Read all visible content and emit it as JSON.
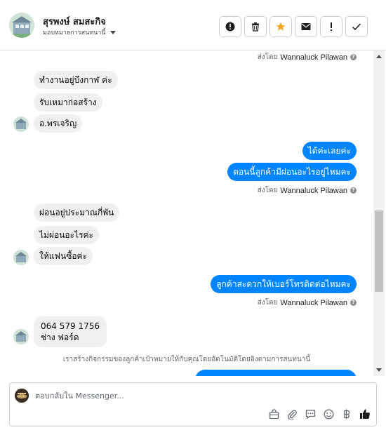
{
  "header": {
    "contact_name": "สุรพงษ์ สมสะกิจ",
    "assign_label": "มอบหมายการสนทนานี้",
    "actions": [
      {
        "icon": "alert-circle-icon"
      },
      {
        "icon": "trash-icon"
      },
      {
        "icon": "star-icon"
      },
      {
        "icon": "envelope-icon"
      },
      {
        "icon": "exclamation-icon"
      },
      {
        "icon": "check-icon"
      }
    ]
  },
  "conversation": {
    "sent_by_prefix": "ส่งโดย",
    "sent_by_name": "Wannaluck Pilawan",
    "incoming_group_1": [
      "ทำงานอยู่บึงกาฬ ค่ะ",
      "รับเหมาก่อสร้าง",
      "อ.พรเจริญ"
    ],
    "outgoing_group_1": [
      "ได้ค่ะเลยค่ะ",
      "ตอนนี้ลูกค้ามีผ่อนอะไรอยู่ไหมคะ"
    ],
    "incoming_group_2": [
      "ผ่อนอยู่ประมาณกี่พัน",
      "ไม่ผ่อนอะไรค่ะ",
      "ให้แฟนซื้อค่ะ"
    ],
    "outgoing_group_2": [
      "ลูกค้าสะดวกให้เบอร์โทรติดต่อไหมคะ"
    ],
    "incoming_group_3": [
      "064 579 1756",
      "ช่าง ฟอร์ด"
    ],
    "system_note": "เราสร้างกิจกรรมของลูกค้าเป้าหมายให้กับคุณโดยอัตโนมัติโดยอิงตามการสนทนานี้"
  },
  "composer": {
    "placeholder": "ตอบกลับใน Messenger...",
    "tools": [
      "shop-bag-icon",
      "paperclip-icon",
      "chat-bubble-icon",
      "emoji-icon",
      "baht-icon",
      "thumbs-up-icon"
    ]
  },
  "colors": {
    "accent": "#0084ff",
    "incoming_bubble": "#f0f0f0",
    "star": "#f5a623"
  }
}
